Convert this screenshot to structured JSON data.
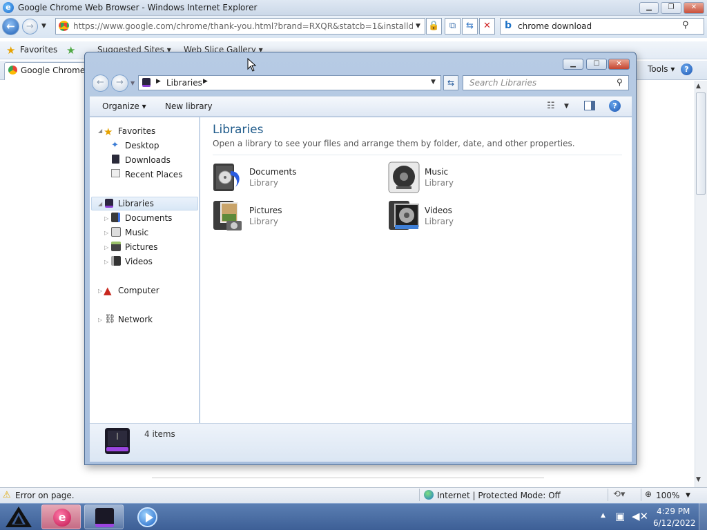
{
  "ie": {
    "title": "Google Chrome Web Browser - Windows Internet Explorer",
    "url": "https://www.google.com/chrome/thank-you.html?brand=RXQR&statcb=1&installdataindex",
    "search_value": "chrome download",
    "favorites_label": "Favorites",
    "suggested_sites": "Suggested Sites ▾",
    "web_slice": "Web Slice Gallery ▾",
    "tab_label": "Google Chrome W",
    "tools_label": "Tools ▾",
    "status_error": "Error on page.",
    "status_zone": "Internet | Protected Mode: Off",
    "zoom": "100%"
  },
  "explorer": {
    "address_label": "Libraries",
    "search_placeholder": "Search Libraries",
    "toolbar": {
      "organize": "Organize ▾",
      "new_library": "New library"
    },
    "nav": {
      "favorites": "Favorites",
      "desktop": "Desktop",
      "downloads": "Downloads",
      "recent": "Recent Places",
      "libraries": "Libraries",
      "documents": "Documents",
      "music": "Music",
      "pictures": "Pictures",
      "videos": "Videos",
      "computer": "Computer",
      "network": "Network"
    },
    "content": {
      "title": "Libraries",
      "subtitle": "Open a library to see your files and arrange them by folder, date, and other properties.",
      "items": [
        {
          "name": "Documents",
          "type": "Library"
        },
        {
          "name": "Music",
          "type": "Library"
        },
        {
          "name": "Pictures",
          "type": "Library"
        },
        {
          "name": "Videos",
          "type": "Library"
        }
      ]
    },
    "details_count": "4 items"
  },
  "taskbar": {
    "time": "4:29 PM",
    "date": "6/12/2022"
  },
  "colors": {
    "accent": "#1e5a8a",
    "taskbar": "#4a6ea4",
    "library_purple": "#8a3fd1"
  }
}
